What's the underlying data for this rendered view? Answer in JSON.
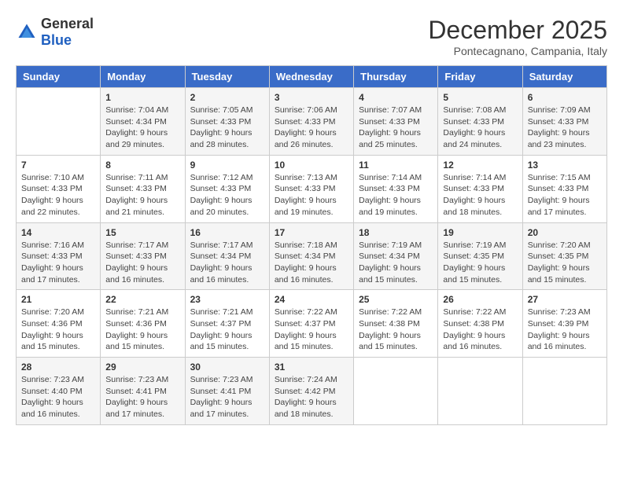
{
  "header": {
    "logo_general": "General",
    "logo_blue": "Blue",
    "title": "December 2025",
    "subtitle": "Pontecagnano, Campania, Italy"
  },
  "weekdays": [
    "Sunday",
    "Monday",
    "Tuesday",
    "Wednesday",
    "Thursday",
    "Friday",
    "Saturday"
  ],
  "weeks": [
    [
      {
        "day": "",
        "sunrise": "",
        "sunset": "",
        "daylight": ""
      },
      {
        "day": "1",
        "sunrise": "Sunrise: 7:04 AM",
        "sunset": "Sunset: 4:34 PM",
        "daylight": "Daylight: 9 hours and 29 minutes."
      },
      {
        "day": "2",
        "sunrise": "Sunrise: 7:05 AM",
        "sunset": "Sunset: 4:33 PM",
        "daylight": "Daylight: 9 hours and 28 minutes."
      },
      {
        "day": "3",
        "sunrise": "Sunrise: 7:06 AM",
        "sunset": "Sunset: 4:33 PM",
        "daylight": "Daylight: 9 hours and 26 minutes."
      },
      {
        "day": "4",
        "sunrise": "Sunrise: 7:07 AM",
        "sunset": "Sunset: 4:33 PM",
        "daylight": "Daylight: 9 hours and 25 minutes."
      },
      {
        "day": "5",
        "sunrise": "Sunrise: 7:08 AM",
        "sunset": "Sunset: 4:33 PM",
        "daylight": "Daylight: 9 hours and 24 minutes."
      },
      {
        "day": "6",
        "sunrise": "Sunrise: 7:09 AM",
        "sunset": "Sunset: 4:33 PM",
        "daylight": "Daylight: 9 hours and 23 minutes."
      }
    ],
    [
      {
        "day": "7",
        "sunrise": "Sunrise: 7:10 AM",
        "sunset": "Sunset: 4:33 PM",
        "daylight": "Daylight: 9 hours and 22 minutes."
      },
      {
        "day": "8",
        "sunrise": "Sunrise: 7:11 AM",
        "sunset": "Sunset: 4:33 PM",
        "daylight": "Daylight: 9 hours and 21 minutes."
      },
      {
        "day": "9",
        "sunrise": "Sunrise: 7:12 AM",
        "sunset": "Sunset: 4:33 PM",
        "daylight": "Daylight: 9 hours and 20 minutes."
      },
      {
        "day": "10",
        "sunrise": "Sunrise: 7:13 AM",
        "sunset": "Sunset: 4:33 PM",
        "daylight": "Daylight: 9 hours and 19 minutes."
      },
      {
        "day": "11",
        "sunrise": "Sunrise: 7:14 AM",
        "sunset": "Sunset: 4:33 PM",
        "daylight": "Daylight: 9 hours and 19 minutes."
      },
      {
        "day": "12",
        "sunrise": "Sunrise: 7:14 AM",
        "sunset": "Sunset: 4:33 PM",
        "daylight": "Daylight: 9 hours and 18 minutes."
      },
      {
        "day": "13",
        "sunrise": "Sunrise: 7:15 AM",
        "sunset": "Sunset: 4:33 PM",
        "daylight": "Daylight: 9 hours and 17 minutes."
      }
    ],
    [
      {
        "day": "14",
        "sunrise": "Sunrise: 7:16 AM",
        "sunset": "Sunset: 4:33 PM",
        "daylight": "Daylight: 9 hours and 17 minutes."
      },
      {
        "day": "15",
        "sunrise": "Sunrise: 7:17 AM",
        "sunset": "Sunset: 4:33 PM",
        "daylight": "Daylight: 9 hours and 16 minutes."
      },
      {
        "day": "16",
        "sunrise": "Sunrise: 7:17 AM",
        "sunset": "Sunset: 4:34 PM",
        "daylight": "Daylight: 9 hours and 16 minutes."
      },
      {
        "day": "17",
        "sunrise": "Sunrise: 7:18 AM",
        "sunset": "Sunset: 4:34 PM",
        "daylight": "Daylight: 9 hours and 16 minutes."
      },
      {
        "day": "18",
        "sunrise": "Sunrise: 7:19 AM",
        "sunset": "Sunset: 4:34 PM",
        "daylight": "Daylight: 9 hours and 15 minutes."
      },
      {
        "day": "19",
        "sunrise": "Sunrise: 7:19 AM",
        "sunset": "Sunset: 4:35 PM",
        "daylight": "Daylight: 9 hours and 15 minutes."
      },
      {
        "day": "20",
        "sunrise": "Sunrise: 7:20 AM",
        "sunset": "Sunset: 4:35 PM",
        "daylight": "Daylight: 9 hours and 15 minutes."
      }
    ],
    [
      {
        "day": "21",
        "sunrise": "Sunrise: 7:20 AM",
        "sunset": "Sunset: 4:36 PM",
        "daylight": "Daylight: 9 hours and 15 minutes."
      },
      {
        "day": "22",
        "sunrise": "Sunrise: 7:21 AM",
        "sunset": "Sunset: 4:36 PM",
        "daylight": "Daylight: 9 hours and 15 minutes."
      },
      {
        "day": "23",
        "sunrise": "Sunrise: 7:21 AM",
        "sunset": "Sunset: 4:37 PM",
        "daylight": "Daylight: 9 hours and 15 minutes."
      },
      {
        "day": "24",
        "sunrise": "Sunrise: 7:22 AM",
        "sunset": "Sunset: 4:37 PM",
        "daylight": "Daylight: 9 hours and 15 minutes."
      },
      {
        "day": "25",
        "sunrise": "Sunrise: 7:22 AM",
        "sunset": "Sunset: 4:38 PM",
        "daylight": "Daylight: 9 hours and 15 minutes."
      },
      {
        "day": "26",
        "sunrise": "Sunrise: 7:22 AM",
        "sunset": "Sunset: 4:38 PM",
        "daylight": "Daylight: 9 hours and 16 minutes."
      },
      {
        "day": "27",
        "sunrise": "Sunrise: 7:23 AM",
        "sunset": "Sunset: 4:39 PM",
        "daylight": "Daylight: 9 hours and 16 minutes."
      }
    ],
    [
      {
        "day": "28",
        "sunrise": "Sunrise: 7:23 AM",
        "sunset": "Sunset: 4:40 PM",
        "daylight": "Daylight: 9 hours and 16 minutes."
      },
      {
        "day": "29",
        "sunrise": "Sunrise: 7:23 AM",
        "sunset": "Sunset: 4:41 PM",
        "daylight": "Daylight: 9 hours and 17 minutes."
      },
      {
        "day": "30",
        "sunrise": "Sunrise: 7:23 AM",
        "sunset": "Sunset: 4:41 PM",
        "daylight": "Daylight: 9 hours and 17 minutes."
      },
      {
        "day": "31",
        "sunrise": "Sunrise: 7:24 AM",
        "sunset": "Sunset: 4:42 PM",
        "daylight": "Daylight: 9 hours and 18 minutes."
      },
      {
        "day": "",
        "sunrise": "",
        "sunset": "",
        "daylight": ""
      },
      {
        "day": "",
        "sunrise": "",
        "sunset": "",
        "daylight": ""
      },
      {
        "day": "",
        "sunrise": "",
        "sunset": "",
        "daylight": ""
      }
    ]
  ]
}
